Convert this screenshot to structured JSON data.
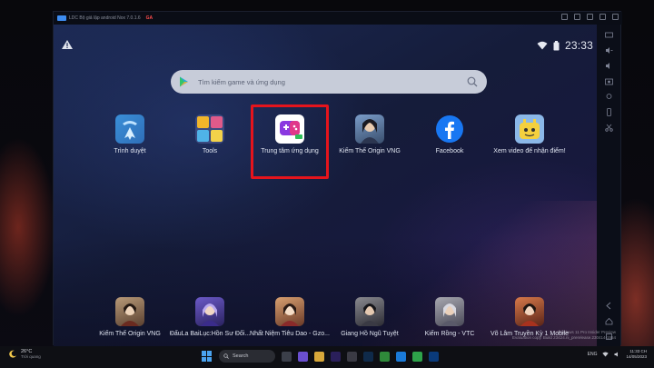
{
  "emulator": {
    "title": "LDC Bộ giả lập android Nox 7.0.1.6",
    "badge": "GA"
  },
  "status_bar": {
    "time": "23:33",
    "icons": [
      "warning-icon",
      "wifi-icon",
      "battery-icon"
    ]
  },
  "search": {
    "placeholder": "Tìm kiếm game và ứng dụng"
  },
  "apps_top": [
    {
      "label": "Trình duyệt",
      "icon": "browser-icon"
    },
    {
      "label": "Tools",
      "icon": "tools-icon"
    },
    {
      "label": "Trung tâm ứng dụng",
      "icon": "app-center-icon",
      "highlighted": true
    },
    {
      "label": "Kiếm Thế Origin VNG",
      "icon": "kiem-the-icon"
    },
    {
      "label": "Facebook",
      "icon": "facebook-icon"
    },
    {
      "label": "Xem video để nhận điểm!",
      "icon": "video-reward-icon"
    }
  ],
  "apps_bottom": [
    {
      "label": "Kiếm Thế Origin VNG",
      "icon": "kiem-the-icon"
    },
    {
      "label": "ĐấuLa BaiLục:Hồn Sư Đối...",
      "icon": "dau-la-icon"
    },
    {
      "label": "Nhất Niệm Tiêu Dao - Gzo...",
      "icon": "nhat-niem-icon"
    },
    {
      "label": "Giang Hồ Ngũ Tuyệt",
      "icon": "giang-ho-icon"
    },
    {
      "label": "Kiếm Rồng - VTC",
      "icon": "kiem-rong-icon"
    },
    {
      "label": "Võ Lâm Truyền Kỳ 1 Mobile",
      "icon": "vo-lam-icon"
    }
  ],
  "taskbar": {
    "weather_temp": "26°C",
    "weather_desc": "Trời quang",
    "search_label": "Search",
    "lang": "ENG",
    "clock_time": "11:33 CH",
    "clock_date": "14/05/2023"
  },
  "watermark": {
    "line1": "Windows 11 Pro Insider Preview",
    "line2": "Evaluation copy. Build 23424.ni_prerelease.230414-1554"
  },
  "colors": {
    "highlight": "#e5141c",
    "search_bg": "#c7ccd9",
    "screen_bg": "#1c2a55"
  }
}
